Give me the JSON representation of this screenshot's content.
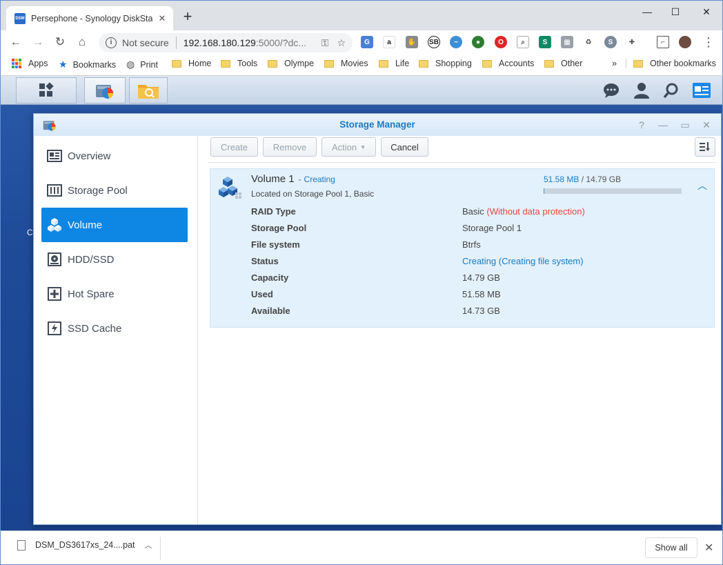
{
  "browser": {
    "tab": {
      "favicon_text": "DSM",
      "title": "Persephone - Synology DiskStation"
    },
    "window_controls": {
      "minimize": "—",
      "maximize": "☐",
      "close": "✕"
    },
    "omnibox": {
      "security": "Not secure",
      "url_host": "192.168.180.129",
      "url_rest": ":5000/?dc..."
    },
    "bookmarks": [
      {
        "label": "Apps"
      },
      {
        "label": "Bookmarks"
      },
      {
        "label": "Print"
      },
      {
        "label": "Home"
      },
      {
        "label": "Tools"
      },
      {
        "label": "Olympe"
      },
      {
        "label": "Movies"
      },
      {
        "label": "Life"
      },
      {
        "label": "Shopping"
      },
      {
        "label": "Accounts"
      },
      {
        "label": "Other"
      }
    ],
    "bookmarks_overflow": "»",
    "other_bookmarks": "Other bookmarks"
  },
  "dsm": {
    "partial_desktop_text": "C",
    "window_title": "Storage Manager",
    "sidebar": [
      {
        "label": "Overview",
        "icon": "overview-icon"
      },
      {
        "label": "Storage Pool",
        "icon": "storage-pool-icon"
      },
      {
        "label": "Volume",
        "icon": "volume-icon",
        "active": true
      },
      {
        "label": "HDD/SSD",
        "icon": "hdd-icon"
      },
      {
        "label": "Hot Spare",
        "icon": "hot-spare-icon"
      },
      {
        "label": "SSD Cache",
        "icon": "ssd-cache-icon"
      }
    ],
    "toolbar": {
      "create": "Create",
      "remove": "Remove",
      "action": "Action",
      "cancel": "Cancel"
    },
    "volume": {
      "name": "Volume 1",
      "state": "Creating",
      "location": "Located on Storage Pool 1, Basic",
      "used": "51.58 MB",
      "total": "14.79 GB",
      "usage_fraction": 0.0034,
      "properties": [
        {
          "label": "RAID Type",
          "value": "Basic",
          "extra": "(Without data protection)"
        },
        {
          "label": "Storage Pool",
          "value": "Storage Pool 1"
        },
        {
          "label": "File system",
          "value": "Btrfs"
        },
        {
          "label": "Status",
          "value": "Creating",
          "extra": "(Creating file system)"
        },
        {
          "label": "Capacity",
          "value": "14.79 GB"
        },
        {
          "label": "Used",
          "value": "51.58 MB"
        },
        {
          "label": "Available",
          "value": "14.73 GB"
        }
      ]
    }
  },
  "downloads": {
    "file": "DSM_DS3617xs_24....pat",
    "show_all": "Show all"
  },
  "colors": {
    "accent": "#0e86e4",
    "warning": "#e8463e",
    "link": "#1b7ac2",
    "panel": "#e3f1fc"
  }
}
